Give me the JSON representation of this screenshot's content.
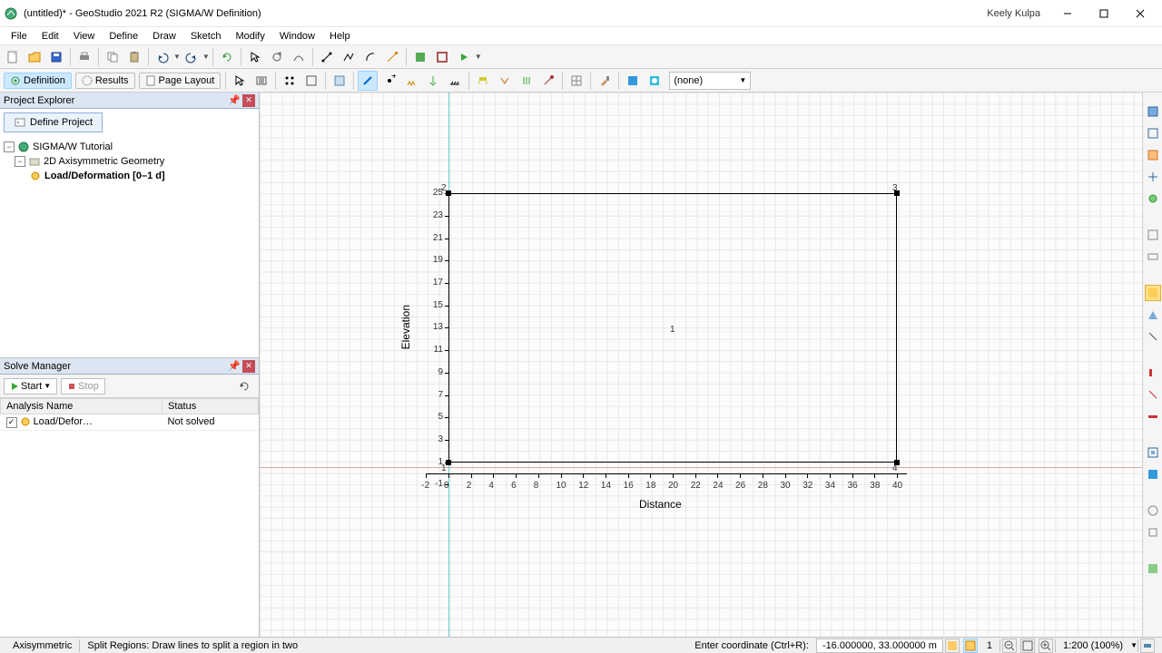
{
  "window": {
    "title": "(untitled)* - GeoStudio 2021 R2 (SIGMA/W Definition)",
    "user": "Keely Kulpa"
  },
  "menu": [
    "File",
    "Edit",
    "View",
    "Define",
    "Draw",
    "Sketch",
    "Modify",
    "Window",
    "Help"
  ],
  "toolbar2": {
    "definition": "Definition",
    "results": "Results",
    "pagelayout": "Page Layout",
    "dropdown": "(none)"
  },
  "project_explorer": {
    "title": "Project Explorer",
    "define_btn": "Define Project",
    "tree": {
      "root": "SIGMA/W Tutorial",
      "geom": "2D Axisymmetric Geometry",
      "analysis": "Load/Deformation [0–1 d]"
    }
  },
  "solve_manager": {
    "title": "Solve Manager",
    "start": "Start",
    "stop": "Stop",
    "col_name": "Analysis Name",
    "col_status": "Status",
    "row_name": "Load/Defor…",
    "row_status": "Not solved"
  },
  "chart_data": {
    "type": "region-plot",
    "title": "",
    "xlabel": "Distance",
    "ylabel": "Elevation",
    "xlim": [
      -2,
      40
    ],
    "ylim": [
      -1,
      26
    ],
    "xticks": [
      -2,
      0,
      2,
      4,
      6,
      8,
      10,
      12,
      14,
      16,
      18,
      20,
      22,
      24,
      26,
      28,
      30,
      32,
      34,
      36,
      38,
      40
    ],
    "yticks": [
      -1,
      1,
      3,
      5,
      7,
      9,
      11,
      13,
      15,
      17,
      19,
      21,
      23,
      25
    ],
    "regions": [
      {
        "id": 1,
        "points": [
          [
            0,
            1
          ],
          [
            0,
            25
          ],
          [
            40,
            25
          ],
          [
            40,
            1
          ]
        ]
      }
    ],
    "region_node_labels": {
      "1": "1",
      "2": "2",
      "3": "3",
      "4": "4"
    },
    "region_center_label": "1",
    "crosshair": {
      "x": 0,
      "y": 0.6
    }
  },
  "statusbar": {
    "mode": "Axisymmetric",
    "hint": "Split Regions: Draw lines to split a region in two",
    "coord_label": "Enter coordinate (Ctrl+R):",
    "coord_value": "-16.000000, 33.000000 m",
    "region_num": "1",
    "zoom": "1:200 (100%)"
  }
}
